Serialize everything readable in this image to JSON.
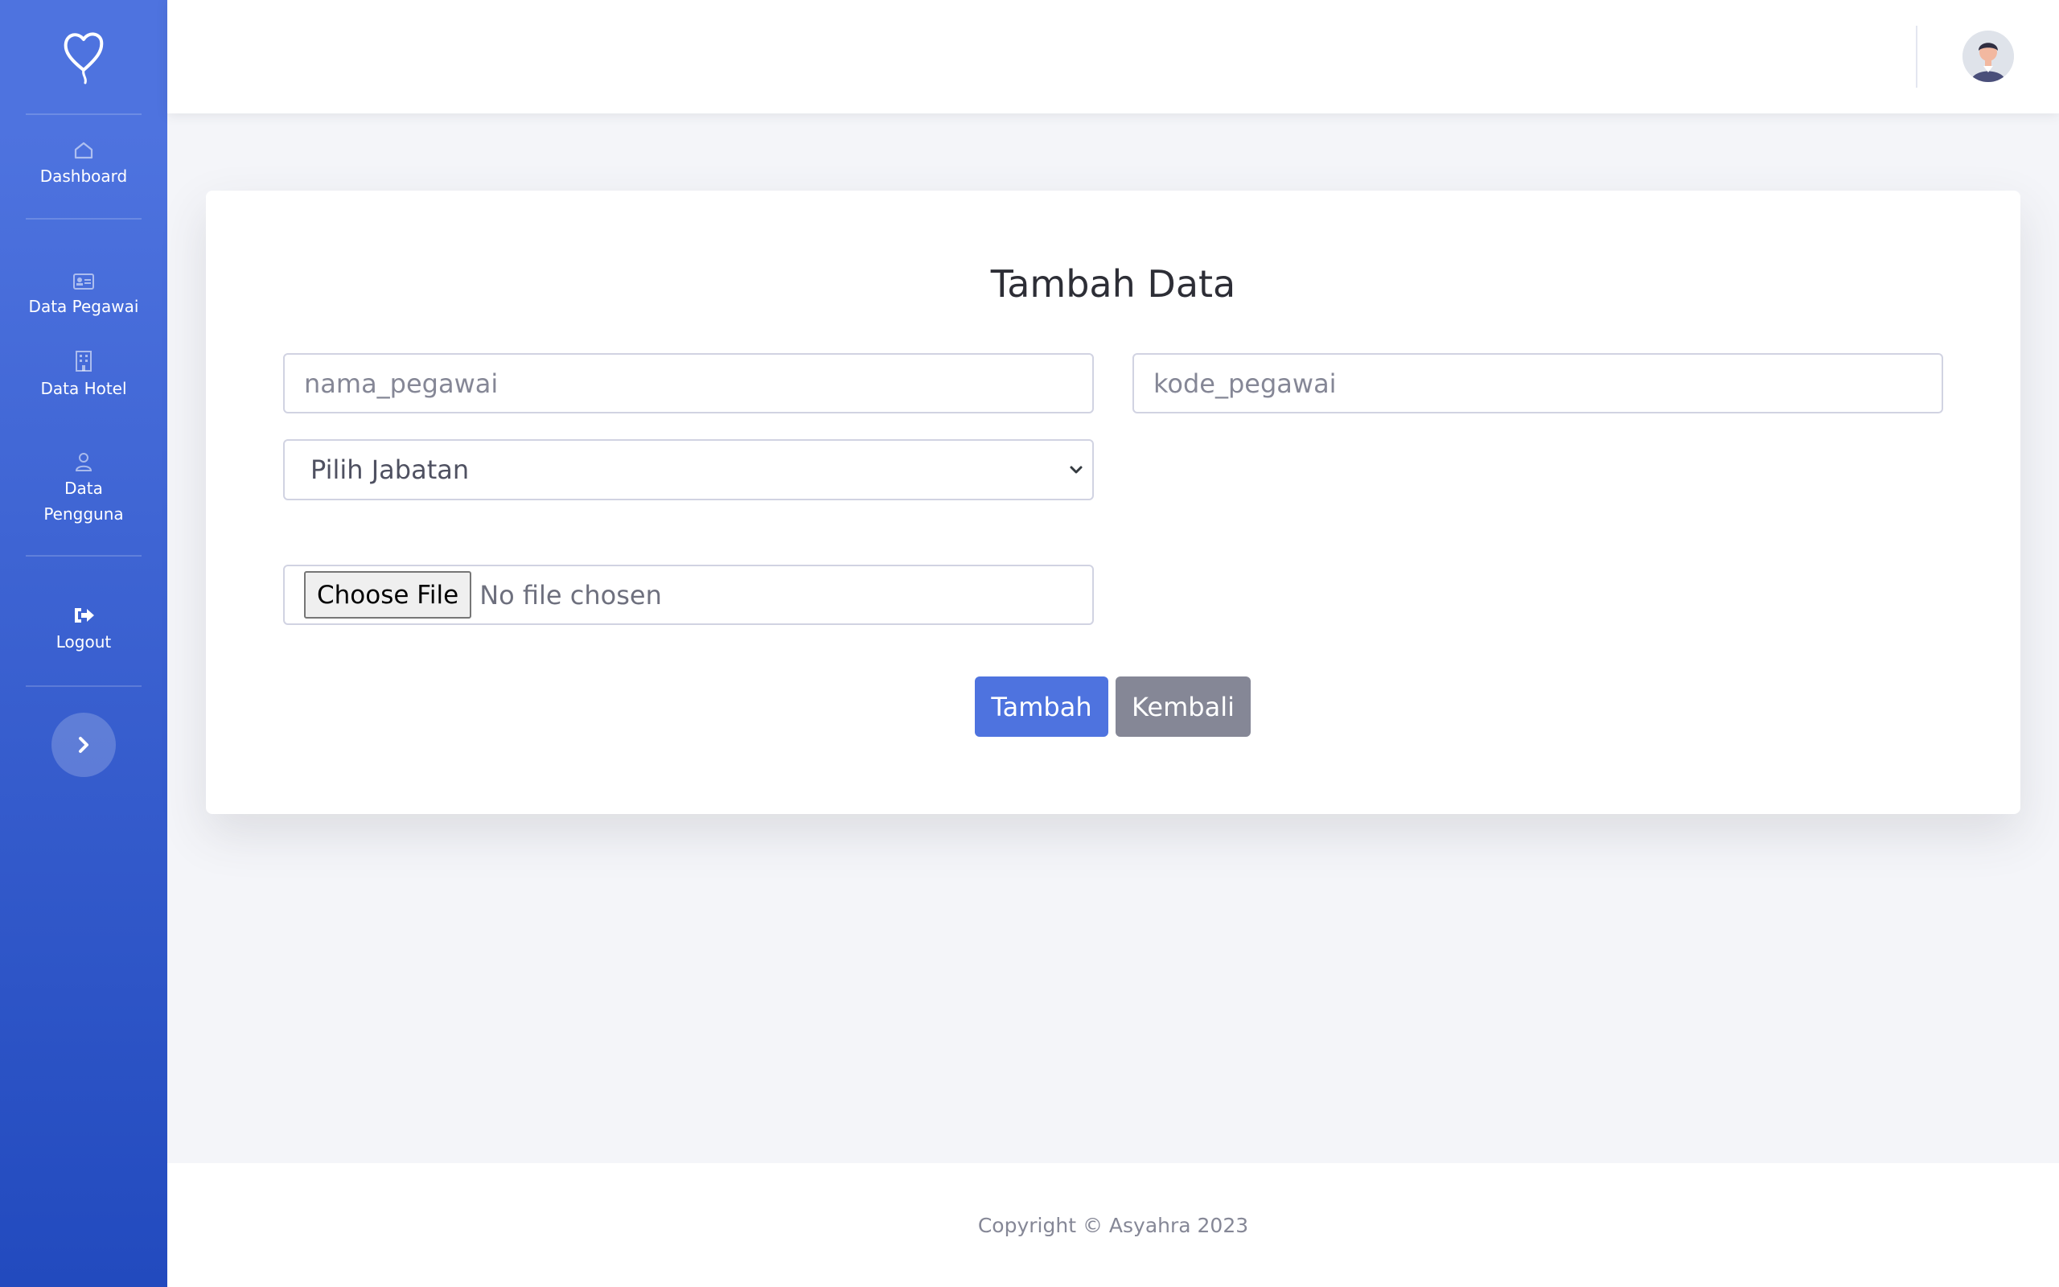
{
  "sidebar": {
    "brand_icon": "heart-balloon-icon",
    "items": [
      {
        "label": "Dashboard",
        "icon": "home-icon"
      },
      {
        "label": "Data Pegawai",
        "icon": "id-card-icon"
      },
      {
        "label": "Data Hotel",
        "icon": "building-icon"
      },
      {
        "label_line1": "Data",
        "label_line2": "Pengguna",
        "icon": "user-icon"
      },
      {
        "label": "Logout",
        "icon": "sign-out-icon"
      }
    ],
    "toggle_icon": "chevron-right-icon"
  },
  "topbar": {
    "avatar": "user-avatar"
  },
  "form": {
    "title": "Tambah Data",
    "nama_placeholder": "nama_pegawai",
    "kode_placeholder": "kode_pegawai",
    "jabatan_selected": "Pilih Jabatan",
    "file_button": "Choose File",
    "file_status": "No file chosen",
    "submit_label": "Tambah",
    "back_label": "Kembali"
  },
  "footer": {
    "text": "Copyright © Asyahra 2023"
  },
  "colors": {
    "primary": "#4e73df",
    "secondary": "#858796",
    "sidebar_gradient_end": "#224abe"
  }
}
